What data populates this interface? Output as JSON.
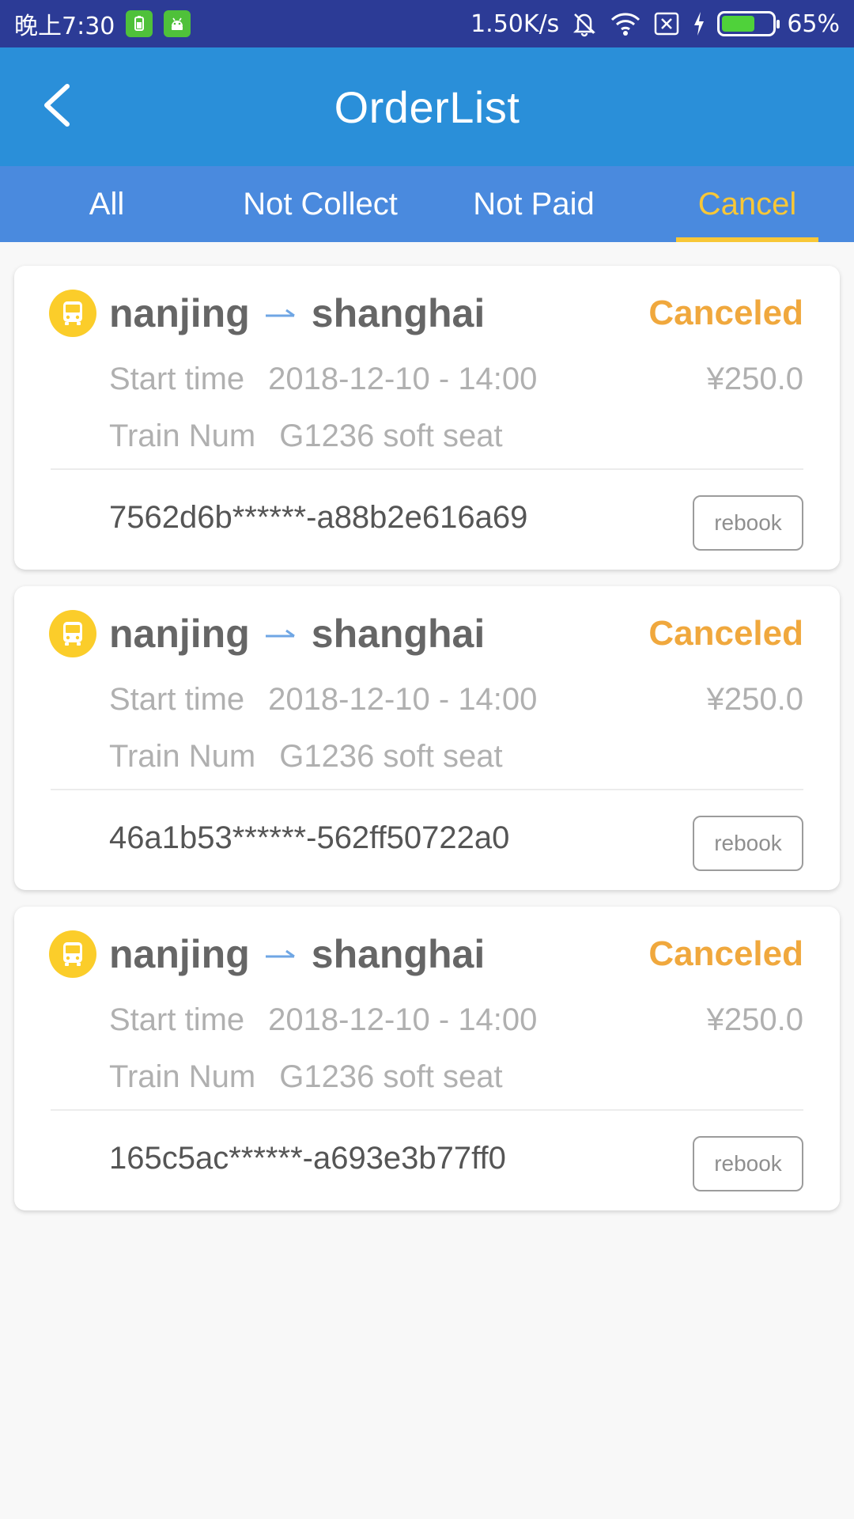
{
  "status_bar": {
    "time": "晚上7:30",
    "net_speed": "1.50K/s",
    "battery": "65%",
    "battery_level": 0.65,
    "icons": [
      "battery-saver-icon",
      "android-icon",
      "mute-vibrate-icon",
      "wifi-icon",
      "sim-no-signal-icon",
      "charging-icon",
      "battery-icon"
    ]
  },
  "header": {
    "title": "OrderList",
    "back_icon": "chevron-left-icon"
  },
  "tabs": [
    {
      "label": "All",
      "active": false
    },
    {
      "label": "Not Collect",
      "active": false
    },
    {
      "label": "Not Paid",
      "active": false
    },
    {
      "label": "Cancel",
      "active": true
    }
  ],
  "colors": {
    "status_bar": "#2c3b96",
    "header": "#2a8fd9",
    "tab_bar": "#4a8ade",
    "active_tab": "#f8c737",
    "status_canceled": "#f0a83d",
    "bus_icon": "#fbcd2a"
  },
  "orders": [
    {
      "from": "nanjing",
      "to": "shanghai",
      "status": "Canceled",
      "start_label": "Start time",
      "start_time": "2018-12-10 - 14:00",
      "price": "¥250.0",
      "train_label": "Train Num",
      "train": "G1236 soft seat",
      "order_id": "7562d6b******-a88b2e616a69",
      "action": "rebook"
    },
    {
      "from": "nanjing",
      "to": "shanghai",
      "status": "Canceled",
      "start_label": "Start time",
      "start_time": "2018-12-10 - 14:00",
      "price": "¥250.0",
      "train_label": "Train Num",
      "train": "G1236 soft seat",
      "order_id": "46a1b53******-562ff50722a0",
      "action": "rebook"
    },
    {
      "from": "nanjing",
      "to": "shanghai",
      "status": "Canceled",
      "start_label": "Start time",
      "start_time": "2018-12-10 - 14:00",
      "price": "¥250.0",
      "train_label": "Train Num",
      "train": "G1236 soft seat",
      "order_id": "165c5ac******-a693e3b77ff0",
      "action": "rebook"
    }
  ]
}
